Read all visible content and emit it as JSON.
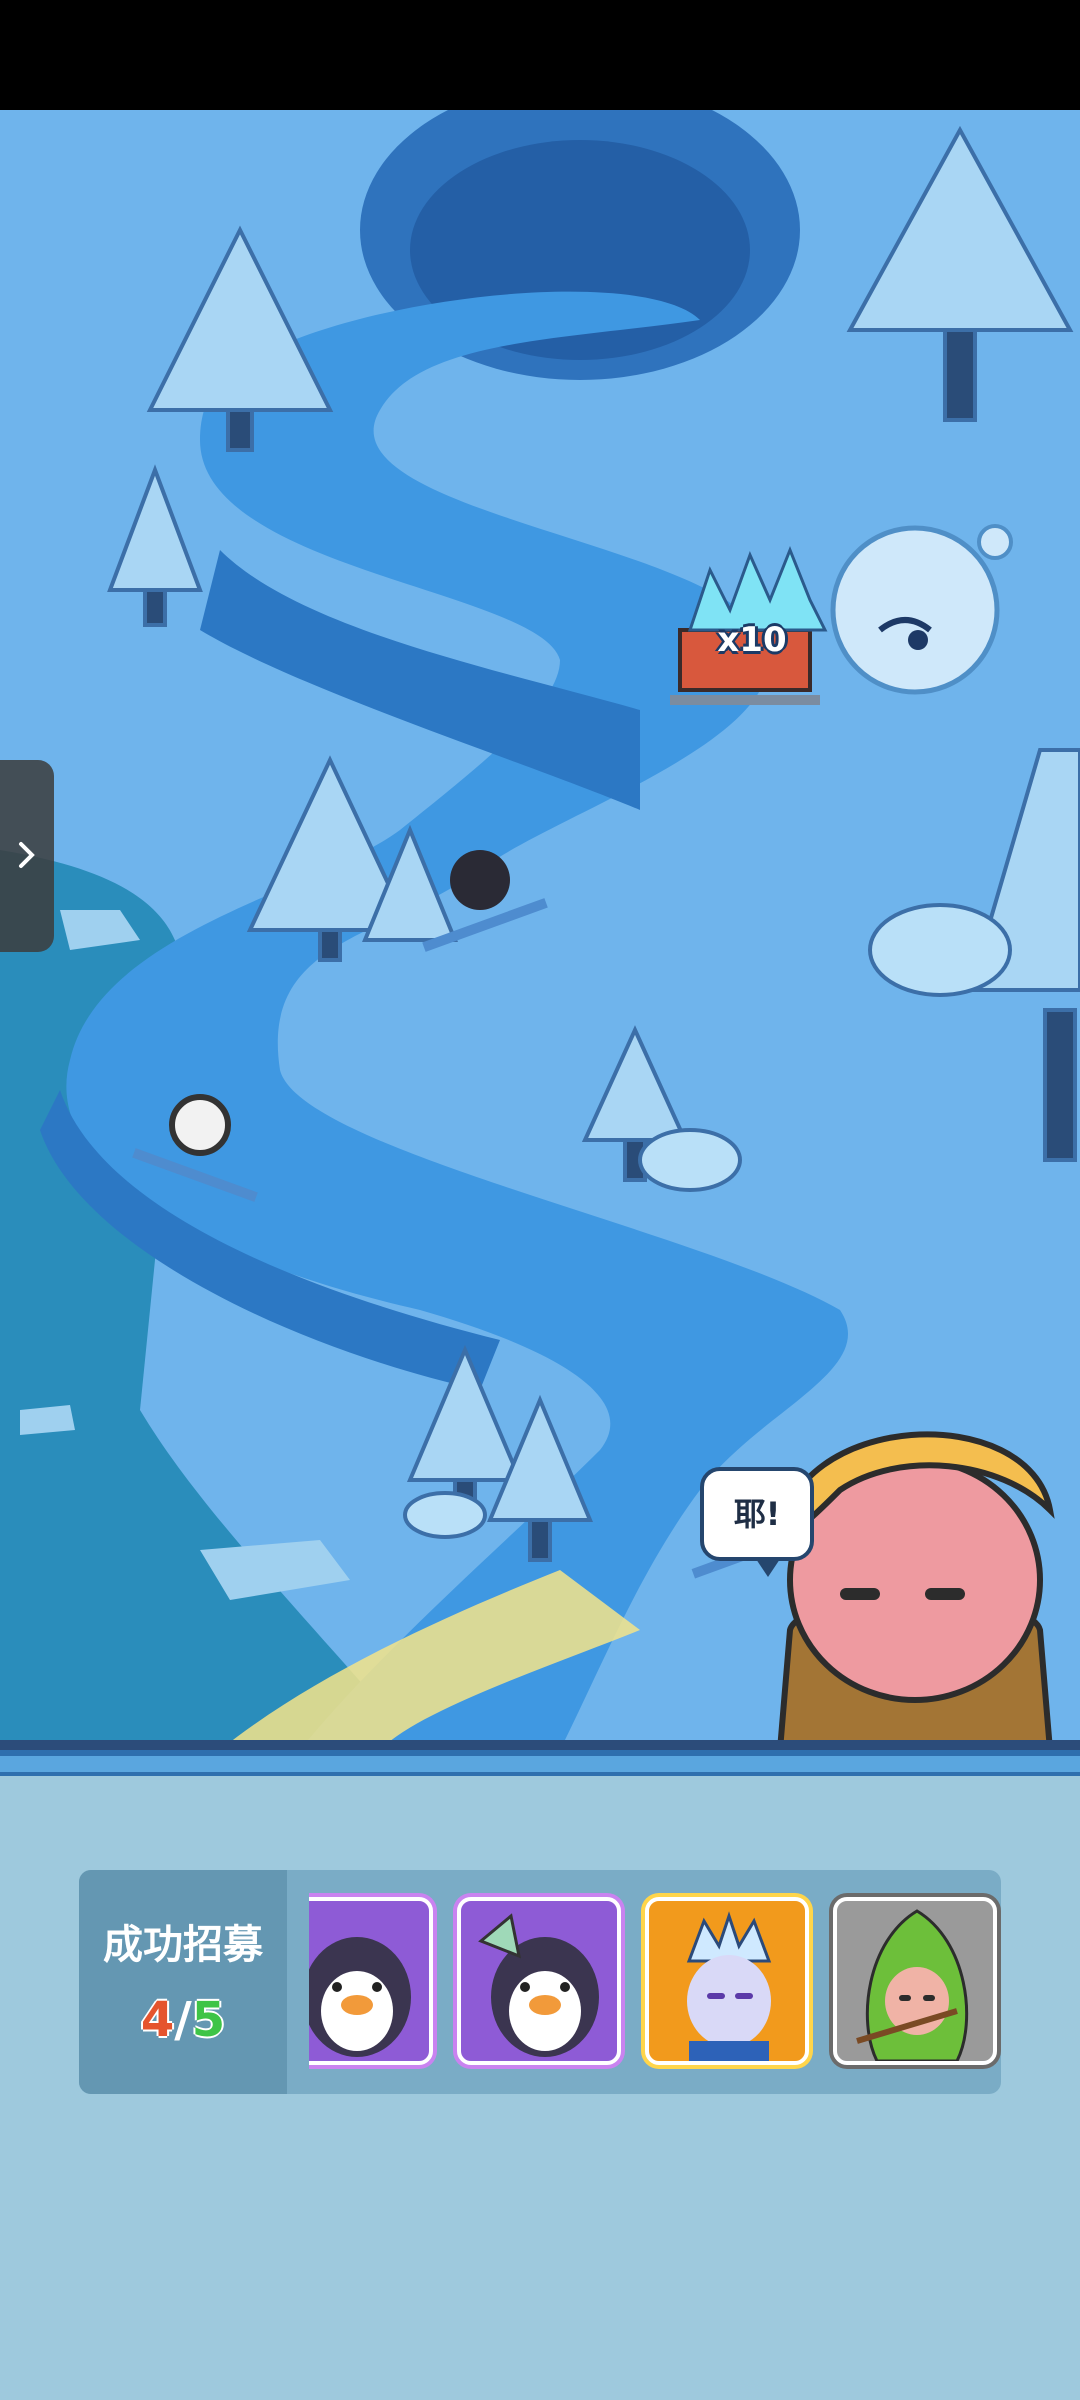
{
  "status_bar": {},
  "game": {
    "side_tab_icon": "chevron-right-icon",
    "reward_multiplier": "x10",
    "speech_bubble": "耶!"
  },
  "recruit": {
    "title": "成功招募",
    "current": "4",
    "separator": "/",
    "total": "5",
    "slots": [
      {
        "character": "penguin-warrior",
        "frame": "purple"
      },
      {
        "character": "penguin-warrior",
        "frame": "purple"
      },
      {
        "character": "ice-queen",
        "frame": "gold"
      },
      {
        "character": "green-hooded-archer",
        "frame": "grey"
      }
    ]
  },
  "colors": {
    "sky_ice": "#6fb4ec",
    "river": "#3f98e2",
    "panel_bg": "#7aacc6",
    "count_current": "#e5542e",
    "count_total": "#3ec447",
    "purple_frame": "#8e5bd6",
    "gold_frame": "#f29a1c"
  }
}
